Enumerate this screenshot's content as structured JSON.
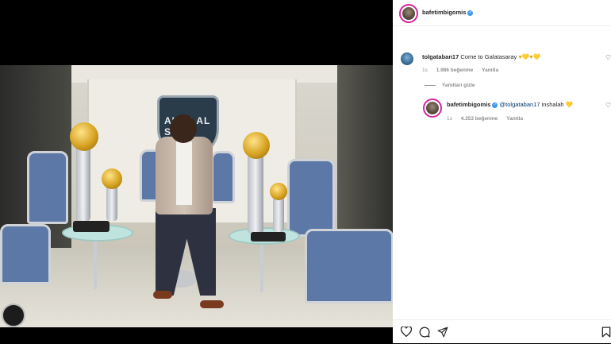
{
  "post": {
    "username": "bafetimbigomis",
    "verified": true
  },
  "comments": [
    {
      "username": "tolgataban17",
      "text": "Come to Galatasaray",
      "emoji": "♥💛♥💛",
      "time": "1s",
      "likes": "1.986 beğenme",
      "reply_label": "Yanıtla"
    }
  ],
  "hide_replies_label": "Yanıtları gizle",
  "replies": [
    {
      "username": "bafetimbigomis",
      "verified": true,
      "mention": "@tolgataban17",
      "text": "inshalah",
      "emoji": "💛",
      "time": "1s",
      "likes": "4.353 beğenme",
      "reply_label": "Yanıtla"
    }
  ],
  "icons": {
    "like": "heart-outline-icon",
    "comment": "comment-bubble-icon",
    "share": "paper-plane-icon",
    "save": "bookmark-icon"
  },
  "photo": {
    "wall_logo_text": "ALHILAL S"
  }
}
